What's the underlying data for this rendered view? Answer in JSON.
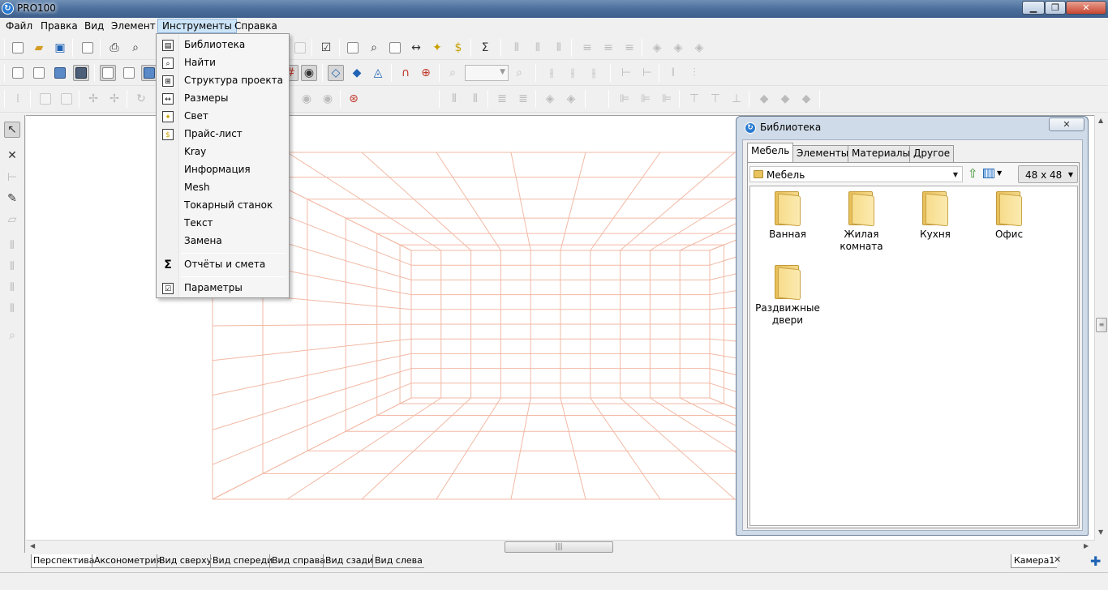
{
  "window": {
    "title": "PRO100",
    "min": "▁",
    "max": "❐",
    "close": "✕"
  },
  "menubar": [
    "Файл",
    "Правка",
    "Вид",
    "Элемент",
    "Инструменты",
    "Справка"
  ],
  "tools_menu": {
    "items": [
      {
        "label": "Библиотека",
        "icon": "library-icon"
      },
      {
        "label": "Найти",
        "icon": "find-icon"
      },
      {
        "label": "Структура проекта",
        "icon": "project-structure-icon"
      },
      {
        "label": "Размеры",
        "icon": "dimensions-icon"
      },
      {
        "label": "Свет",
        "icon": "light-icon"
      },
      {
        "label": "Прайс-лист",
        "icon": "price-list-icon"
      },
      {
        "label": "Kray",
        "icon": ""
      },
      {
        "label": "Информация",
        "icon": ""
      },
      {
        "label": "Mesh",
        "icon": ""
      },
      {
        "label": "Токарный станок",
        "icon": ""
      },
      {
        "label": "Текст",
        "icon": ""
      },
      {
        "label": "Замена",
        "icon": ""
      }
    ],
    "reports": {
      "label": "Отчёты и смета",
      "icon": "sigma-icon"
    },
    "settings": {
      "label": "Параметры",
      "icon": "settings-checkbox-icon"
    }
  },
  "library": {
    "title": "Библиотека",
    "close": "✕",
    "tabs": [
      "Мебель",
      "Элементы",
      "Материалы",
      "Другое"
    ],
    "path": "Мебель",
    "icon_size": "48 x  48",
    "folders": [
      "Ванная",
      "Жилая комната",
      "Кухня",
      "Офис",
      "Раздвижные двери"
    ]
  },
  "view_tabs": [
    "Перспектива",
    "Аксонометрия",
    "Вид сверху",
    "Вид спереди",
    "Вид справа",
    "Вид сзади",
    "Вид слева"
  ],
  "camera_tab": "Камера1",
  "scrollbar_grip": "|||",
  "colors": {
    "grid": "#f2b9a5",
    "accent": "#cce4f7",
    "panel": "#cfdbe8"
  }
}
